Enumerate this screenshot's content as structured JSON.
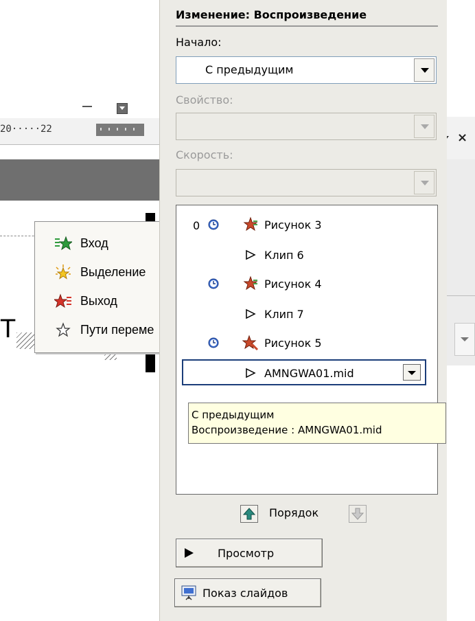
{
  "background": {
    "ruler_text": "20·····22",
    "stray_text": "Т"
  },
  "context_menu": {
    "items": [
      {
        "label": "Вход",
        "icon": "entrance-star-green-icon",
        "color": "#2e9b3c"
      },
      {
        "label": "Выделение",
        "icon": "emphasis-star-yellow-icon",
        "color": "#f3c623"
      },
      {
        "label": "Выход",
        "icon": "exit-star-red-icon",
        "color": "#d5342a"
      },
      {
        "label": "Пути переме",
        "icon": "motion-path-star-icon",
        "color": "#ffffff"
      }
    ]
  },
  "task_pane": {
    "title": "Изменение: Воспроизведение",
    "start_label": "Начало:",
    "start_value": "С предыдущим",
    "property_label": "Свойство:",
    "property_value": "",
    "speed_label": "Скорость:",
    "speed_value": "",
    "list": [
      {
        "index": "0",
        "trigger": "clock-icon",
        "effect": "effect-icon",
        "label": "Рисунок 3"
      },
      {
        "index": "",
        "trigger": "",
        "effect": "play-icon",
        "label": "Клип 6"
      },
      {
        "index": "",
        "trigger": "clock-icon",
        "effect": "effect-icon",
        "label": "Рисунок 4"
      },
      {
        "index": "",
        "trigger": "",
        "effect": "play-icon",
        "label": "Клип 7"
      },
      {
        "index": "",
        "trigger": "clock-icon",
        "effect": "effect-icon",
        "label": "Рисунок 5"
      }
    ],
    "selected_item": {
      "label": "AMNGWA01.mid",
      "effect": "play-icon"
    },
    "tooltip": {
      "line1": "С предыдущим",
      "line2": "Воспроизведение : AMNGWA01.mid"
    },
    "order_label": "Порядок",
    "preview_label": "Просмотр",
    "slideshow_label": "Показ слайдов"
  },
  "colors": {
    "pane_bg": "#ecebe6",
    "selection_border": "#1b3d79",
    "tooltip_bg": "#ffffe1",
    "order_up_accent": "#2a8a7e"
  }
}
